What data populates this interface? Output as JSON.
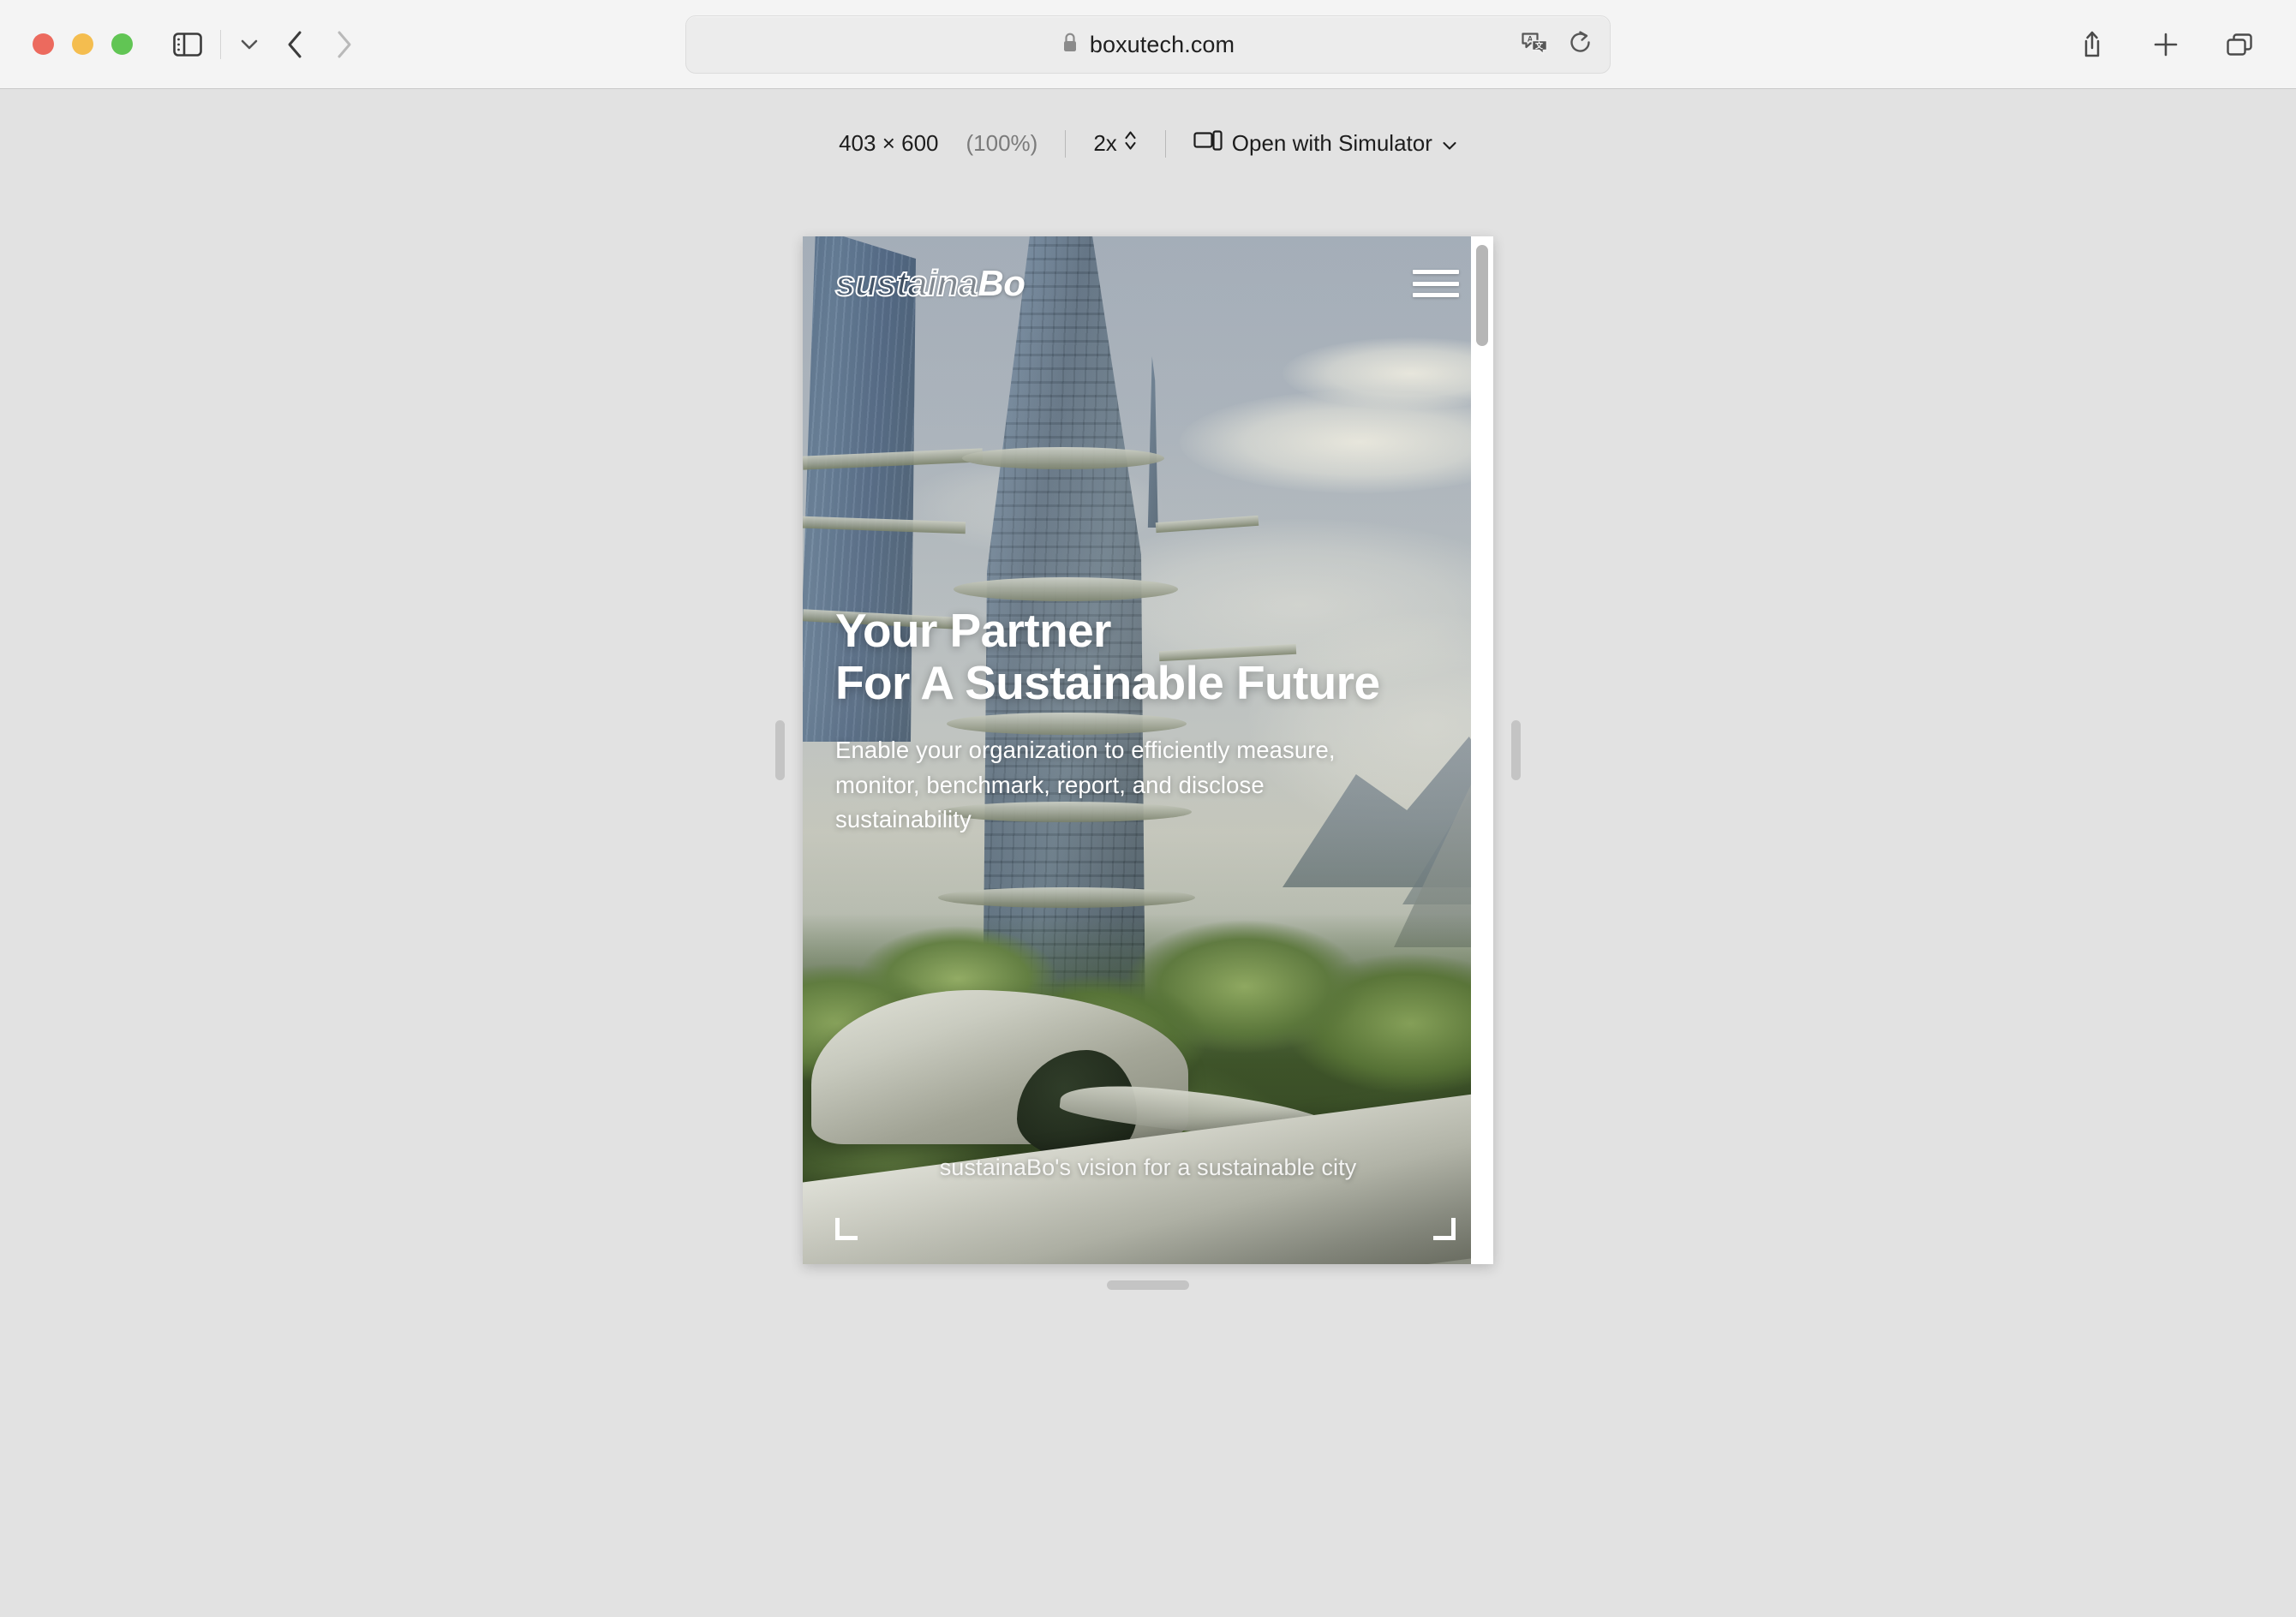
{
  "browser": {
    "window_controls": {
      "close": "close",
      "minimize": "minimize",
      "zoom": "zoom"
    },
    "sidebar_toggle_label": "Show Sidebar",
    "tab_group_chevron_label": "Tab Group Menu",
    "back_label": "Back",
    "forward_label": "Forward",
    "address": {
      "url": "boxutech.com",
      "lock": "lock-icon",
      "translate": "translate-icon",
      "reload": "reload-icon"
    },
    "actions": {
      "share": "share-icon",
      "new_tab": "plus-icon",
      "tab_overview": "tab-overview-icon"
    }
  },
  "responsive_mode": {
    "dimensions": "403 × 600",
    "zoom_percent": "(100%)",
    "scale": "2x",
    "scale_stepper": "stepper-icon",
    "simulator_icon": "device-icon",
    "simulator_label": "Open with Simulator",
    "simulator_chevron": "chevron-down-icon"
  },
  "page": {
    "logo": {
      "light": "sustaina",
      "bold": "Bo"
    },
    "menu_label": "Open menu",
    "hero": {
      "title_line1": "Your Partner",
      "title_line2": "For A Sustainable Future",
      "subtitle": "Enable your organization to efficiently measure, monitor, benchmark, report, and disclose sustainability",
      "caption": "sustainaBo's vision for a sustainable city"
    }
  },
  "colors": {
    "traffic_red": "#ec6a5e",
    "traffic_yellow": "#f4bd4f",
    "traffic_green": "#61c554",
    "toolbar_bg": "#f4f4f4",
    "content_bg": "#e2e2e2",
    "hero_text": "#ffffff"
  }
}
